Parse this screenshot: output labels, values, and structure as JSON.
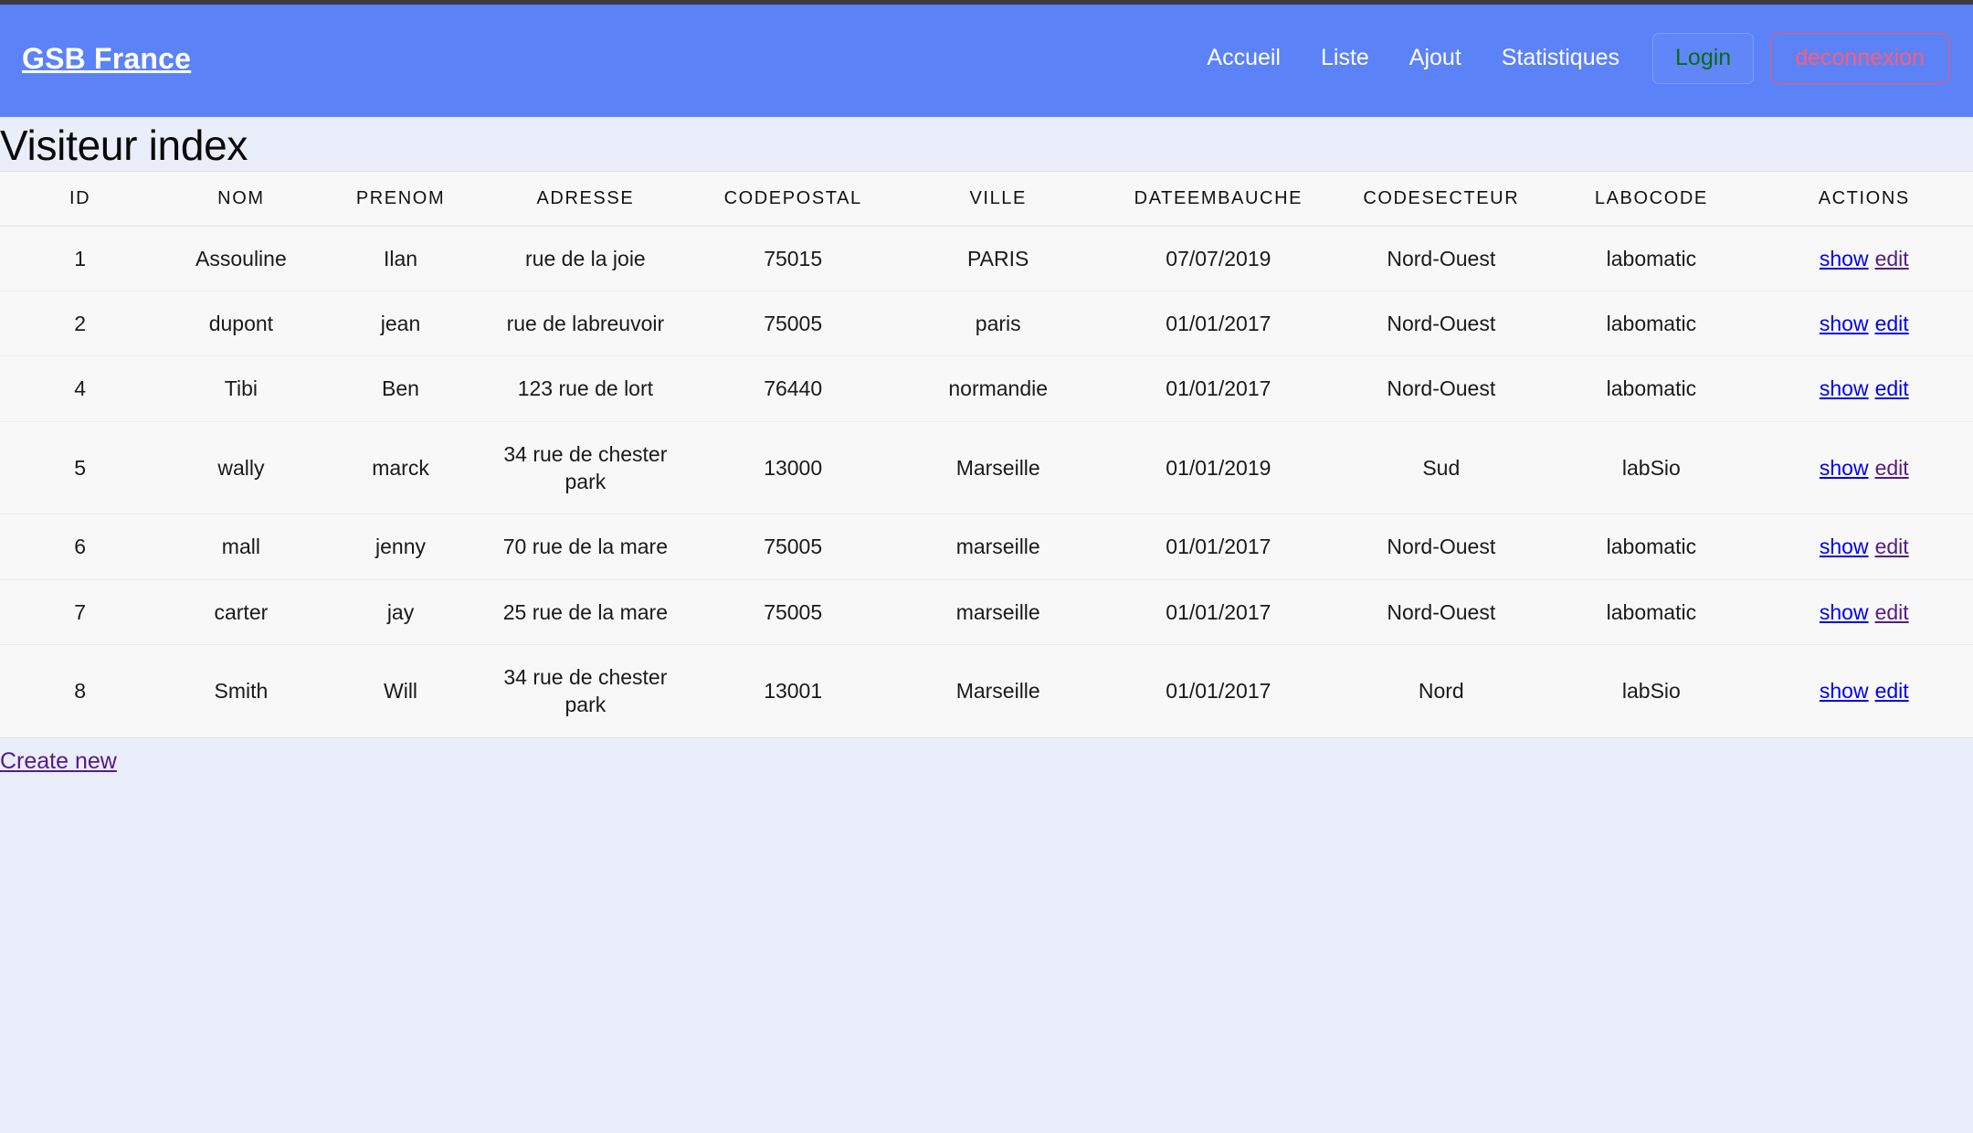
{
  "colors": {
    "navbar_bg": "#5c82f7",
    "page_bg": "#eaeefa",
    "table_bg": "#f8f8f8",
    "login_text": "#0a6b16",
    "logout_text": "#fb5d76",
    "logout_border": "#f4566e",
    "link_blue": "#0000ee",
    "link_purple": "#551a8b"
  },
  "navbar": {
    "brand": "GSB France",
    "links": [
      {
        "label": "Accueil"
      },
      {
        "label": "Liste"
      },
      {
        "label": "Ajout"
      },
      {
        "label": "Statistiques"
      }
    ],
    "login_label": "Login",
    "logout_label": "deconnexion"
  },
  "page": {
    "title": "Visiteur index",
    "create_new_label": "Create new"
  },
  "table": {
    "headers": [
      "ID",
      "NOM",
      "PRENOM",
      "ADRESSE",
      "CODEPOSTAL",
      "VILLE",
      "DATEEMBAUCHE",
      "CODESECTEUR",
      "LABOCODE",
      "ACTIONS"
    ],
    "action_labels": {
      "show": "show",
      "edit": "edit"
    },
    "rows": [
      {
        "id": "1",
        "nom": "Assouline",
        "prenom": "Ilan",
        "adresse": "rue de la joie",
        "codepostal": "75015",
        "ville": "PARIS",
        "dateembauche": "07/07/2019",
        "codesecteur": "Nord-Ouest",
        "labocode": "labomatic",
        "show_color": "#0000ee",
        "edit_color": "#551a8b"
      },
      {
        "id": "2",
        "nom": "dupont",
        "prenom": "jean",
        "adresse": "rue de labreuvoir",
        "codepostal": "75005",
        "ville": "paris",
        "dateembauche": "01/01/2017",
        "codesecteur": "Nord-Ouest",
        "labocode": "labomatic",
        "show_color": "#0000ee",
        "edit_color": "#0000ee"
      },
      {
        "id": "4",
        "nom": "Tibi",
        "prenom": "Ben",
        "adresse": "123 rue de lort",
        "codepostal": "76440",
        "ville": "normandie",
        "dateembauche": "01/01/2017",
        "codesecteur": "Nord-Ouest",
        "labocode": "labomatic",
        "show_color": "#0000ee",
        "edit_color": "#0000ee"
      },
      {
        "id": "5",
        "nom": "wally",
        "prenom": "marck",
        "adresse": "34 rue de chester park",
        "codepostal": "13000",
        "ville": "Marseille",
        "dateembauche": "01/01/2019",
        "codesecteur": "Sud",
        "labocode": "labSio",
        "show_color": "#0000ee",
        "edit_color": "#551a8b"
      },
      {
        "id": "6",
        "nom": "mall",
        "prenom": "jenny",
        "adresse": "70 rue de la mare",
        "codepostal": "75005",
        "ville": "marseille",
        "dateembauche": "01/01/2017",
        "codesecteur": "Nord-Ouest",
        "labocode": "labomatic",
        "show_color": "#0000ee",
        "edit_color": "#551a8b"
      },
      {
        "id": "7",
        "nom": "carter",
        "prenom": "jay",
        "adresse": "25 rue de la mare",
        "codepostal": "75005",
        "ville": "marseille",
        "dateembauche": "01/01/2017",
        "codesecteur": "Nord-Ouest",
        "labocode": "labomatic",
        "show_color": "#0000ee",
        "edit_color": "#551a8b"
      },
      {
        "id": "8",
        "nom": "Smith",
        "prenom": "Will",
        "adresse": "34 rue de chester park",
        "codepostal": "13001",
        "ville": "Marseille",
        "dateembauche": "01/01/2017",
        "codesecteur": "Nord",
        "labocode": "labSio",
        "show_color": "#0000ee",
        "edit_color": "#0000ee"
      }
    ]
  }
}
